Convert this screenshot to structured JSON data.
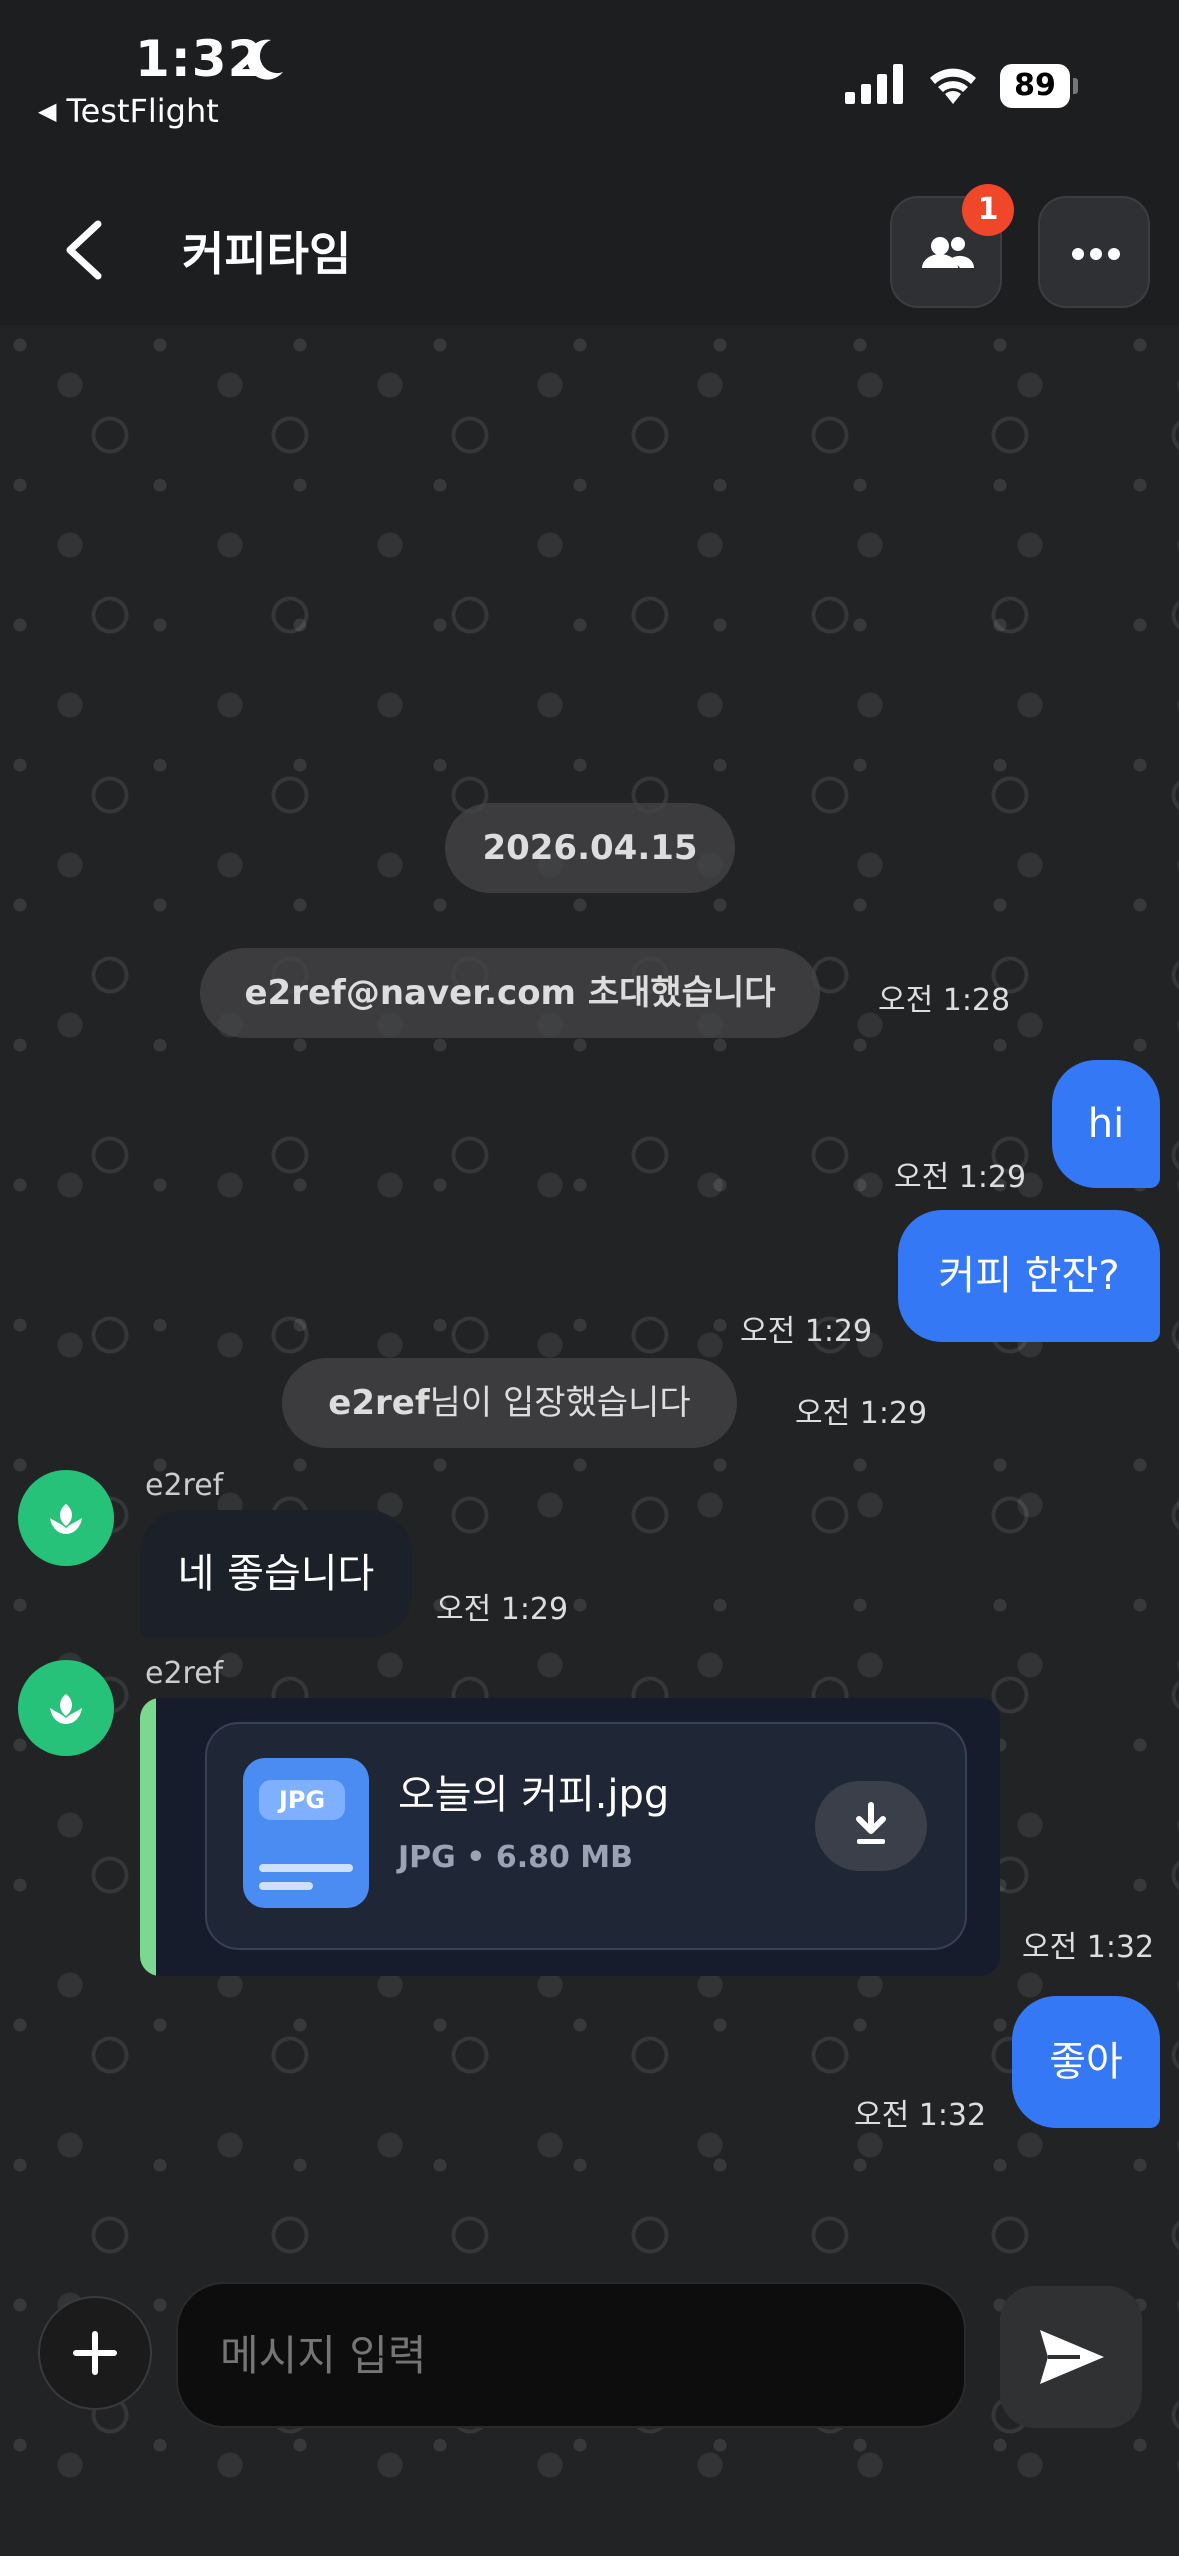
{
  "status_bar": {
    "time": "1:32",
    "back_app": "TestFlight",
    "battery": "89"
  },
  "header": {
    "title": "커피타임",
    "members_badge": "1"
  },
  "messages": {
    "date": "2026.04.15",
    "system_invite": "e2ref@naver.com 초대했습니다",
    "system_invite_time": "오전 1:28",
    "out1": {
      "text": "hi",
      "time": "오전 1:29"
    },
    "out2": {
      "text": "커피 한잔?",
      "time": "오전 1:29"
    },
    "system_join_name": "e2ref",
    "system_join_suffix": "님이 입장했습니다",
    "system_join_time": "오전 1:29",
    "in1": {
      "sender": "e2ref",
      "text": "네 좋습니다",
      "time": "오전 1:29"
    },
    "in2": {
      "sender": "e2ref",
      "file_badge": "JPG",
      "file_name": "오늘의 커피.jpg",
      "file_info": "JPG • 6.80 MB",
      "time": "오전 1:32"
    },
    "out3": {
      "text": "좋아",
      "time": "오전 1:32"
    }
  },
  "composer": {
    "placeholder": "메시지 입력"
  },
  "colors": {
    "accent": "#3478f6",
    "badge": "#f0462a",
    "avatar": "#27c27a",
    "file_bar": "#7bd88f"
  }
}
